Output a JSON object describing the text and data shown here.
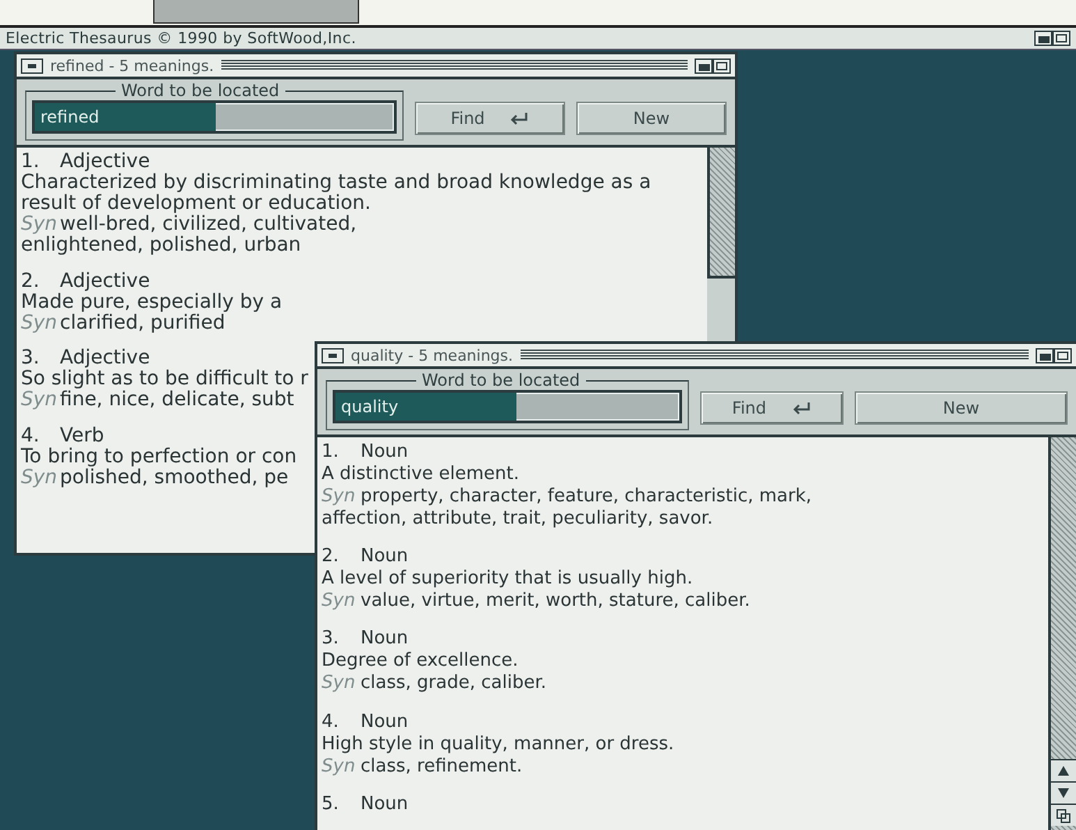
{
  "app": {
    "title": "Electric Thesaurus © 1990 by SoftWood,Inc."
  },
  "windows": [
    {
      "title": "refined - 5 meanings.",
      "legend": "Word to be located",
      "value": "refined",
      "value_highlighted": true,
      "buttons": [
        {
          "label": "Find",
          "kind": "enter"
        },
        {
          "label": "New",
          "kind": "plain"
        }
      ],
      "entries": [
        {
          "number": "1.",
          "pos": "Adjective",
          "definition": [
            "Characterized by discriminating taste and broad knowledge as a",
            "result of development or education."
          ],
          "syn_label": "Syn",
          "synonyms": [
            "well-bred, civilized, cultivated,",
            "enlightened, polished, urban"
          ]
        },
        {
          "number": "2.",
          "pos": "Adjective",
          "definition": [
            "Made pure, especially by a"
          ],
          "syn_label": "Syn",
          "synonyms": [
            "clarified, purified"
          ]
        },
        {
          "number": "3.",
          "pos": "Adjective",
          "definition": [
            "So slight as to be difficult to r"
          ],
          "syn_label": "Syn",
          "synonyms": [
            "fine, nice, delicate, subt"
          ]
        },
        {
          "number": "4.",
          "pos": "Verb",
          "definition": [
            "To bring to perfection or con"
          ],
          "syn_label": "Syn",
          "synonyms": [
            "polished, smoothed, pe"
          ]
        }
      ]
    },
    {
      "title": "quality - 5 meanings.",
      "legend": "Word to be located",
      "value": "quality",
      "value_highlighted": true,
      "buttons": [
        {
          "label": "Find",
          "kind": "enter"
        },
        {
          "label": "New",
          "kind": "plain"
        }
      ],
      "entries": [
        {
          "number": "1.",
          "pos": "Noun",
          "definition": [
            "A distinctive element."
          ],
          "syn_label": "Syn",
          "synonyms": [
            "property, character, feature, characteristic, mark,",
            "affection, attribute, trait, peculiarity, savor."
          ]
        },
        {
          "number": "2.",
          "pos": "Noun",
          "definition": [
            "A level of superiority that is usually high."
          ],
          "syn_label": "Syn",
          "synonyms": [
            "value, virtue, merit, worth, stature, caliber."
          ]
        },
        {
          "number": "3.",
          "pos": "Noun",
          "definition": [
            "Degree of excellence."
          ],
          "syn_label": "Syn",
          "synonyms": [
            "class, grade, caliber."
          ]
        },
        {
          "number": "4.",
          "pos": "Noun",
          "definition": [
            "High style in quality, manner, or dress."
          ],
          "syn_label": "Syn",
          "synonyms": [
            "class, refinement."
          ]
        },
        {
          "number": "5.",
          "pos": "Noun"
        }
      ]
    }
  ]
}
